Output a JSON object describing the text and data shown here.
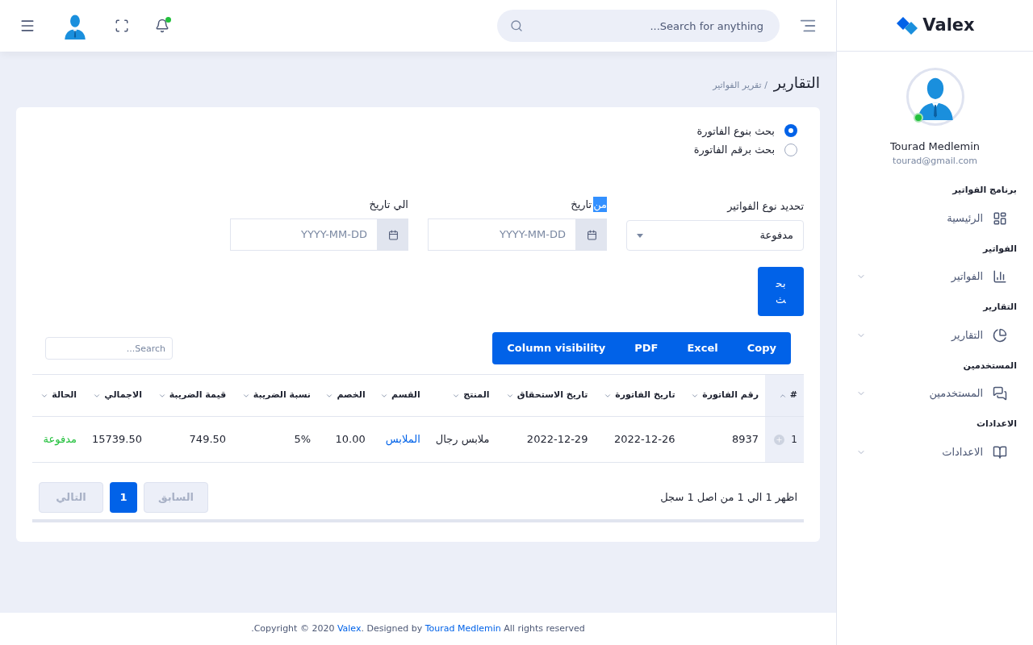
{
  "header": {
    "search": {
      "placeholder": "Search for anything..."
    },
    "notification_dot": true
  },
  "sidebar": {
    "logo": "Valex",
    "user": {
      "name": "Tourad Medlemin",
      "email": "tourad@gmail.com",
      "online": true
    },
    "sections": [
      {
        "title": "برنامج الفواتير",
        "item": {
          "label": "الرئيسية",
          "expandable": false
        }
      },
      {
        "title": "الفواتير",
        "item": {
          "label": "الفواتير",
          "expandable": true
        }
      },
      {
        "title": "التقارير",
        "item": {
          "label": "التقارير",
          "expandable": true
        }
      },
      {
        "title": "المستخدمين",
        "item": {
          "label": "المستخدمين",
          "expandable": true
        }
      },
      {
        "title": "الاعدادات",
        "item": {
          "label": "الاعدادات",
          "expandable": true
        }
      }
    ]
  },
  "breadcrumb": {
    "title": "التقارير",
    "current": "/ تقرير الفواتير"
  },
  "search_mode": [
    {
      "label": "بحث بنوع الفاتورة",
      "selected": true
    },
    {
      "label": "بحث برقم الفاتورة",
      "selected": false
    }
  ],
  "filters": {
    "type_label": "تحديد نوع الفواتير",
    "type_value": "مدفوعة",
    "from_label": [
      {
        "text": "من",
        "highlighted": true
      },
      {
        "text": "تاريخ",
        "highlighted": false
      }
    ],
    "from_placeholder": "YYYY-MM-DD",
    "to_label": "الي تاريخ",
    "to_placeholder": "YYYY-MM-DD",
    "submit": "بحث"
  },
  "export_buttons": [
    "Copy",
    "Excel",
    "PDF",
    "Column visibility"
  ],
  "table_search": {
    "placeholder": "Search..."
  },
  "table": {
    "columns": [
      "#",
      "رقم الفاتورة",
      "تاريخ الفاتورة",
      "تاريخ الاستحقاق",
      "المنتج",
      "القسم",
      "الخصم",
      "نسبة الضريبة",
      "قيمة الضريبة",
      "الاجمالي",
      "الحالة"
    ],
    "rows": [
      {
        "cells": [
          "1",
          "8937",
          "2022-12-26",
          "2022-12-29",
          "ملابس رجال",
          "الملابس",
          "10.00",
          "5%",
          "749.50",
          "15739.50",
          "مدفوعة"
        ]
      }
    ]
  },
  "info": "اظهر 1 الي 1 من اصل 1 سجل",
  "pagination": [
    {
      "label": "السابق",
      "kind": "prev",
      "disabled": true,
      "selected": false
    },
    {
      "label": "1",
      "kind": "page",
      "disabled": false,
      "selected": true
    },
    {
      "label": "التالي",
      "kind": "next",
      "disabled": true,
      "selected": false
    }
  ],
  "footer": {
    "prefix": ".Copyright © 2020 ",
    "brand": "Valex",
    "middle": ". Designed by ",
    "author": "Tourad Medlemin",
    "suffix": " All rights reserved"
  }
}
